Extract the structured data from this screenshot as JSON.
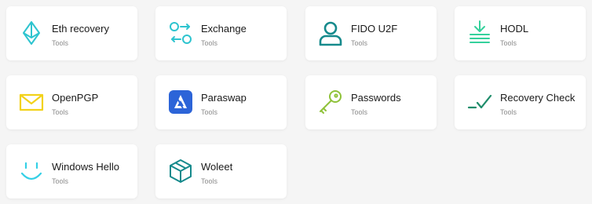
{
  "apps": [
    {
      "name": "Eth recovery",
      "category": "Tools",
      "icon": "ethereum-icon",
      "color": "#2ec4cf"
    },
    {
      "name": "Exchange",
      "category": "Tools",
      "icon": "exchange-arrows-icon",
      "color": "#2ec4cf"
    },
    {
      "name": "FIDO U2F",
      "category": "Tools",
      "icon": "user-icon",
      "color": "#168a8c"
    },
    {
      "name": "HODL",
      "category": "Tools",
      "icon": "download-tray-icon",
      "color": "#35d19c"
    },
    {
      "name": "OpenPGP",
      "category": "Tools",
      "icon": "envelope-icon",
      "color": "#f2d21a"
    },
    {
      "name": "Paraswap",
      "category": "Tools",
      "icon": "paraswap-logo-icon",
      "color": "#2c64d8"
    },
    {
      "name": "Passwords",
      "category": "Tools",
      "icon": "key-icon",
      "color": "#8fc23a"
    },
    {
      "name": "Recovery Check",
      "category": "Tools",
      "icon": "checkmark-icon",
      "color": "#1e8c6a"
    },
    {
      "name": "Windows Hello",
      "category": "Tools",
      "icon": "smiley-face-icon",
      "color": "#35d0e6"
    },
    {
      "name": "Woleet",
      "category": "Tools",
      "icon": "cube-icon",
      "color": "#168a8c"
    }
  ]
}
